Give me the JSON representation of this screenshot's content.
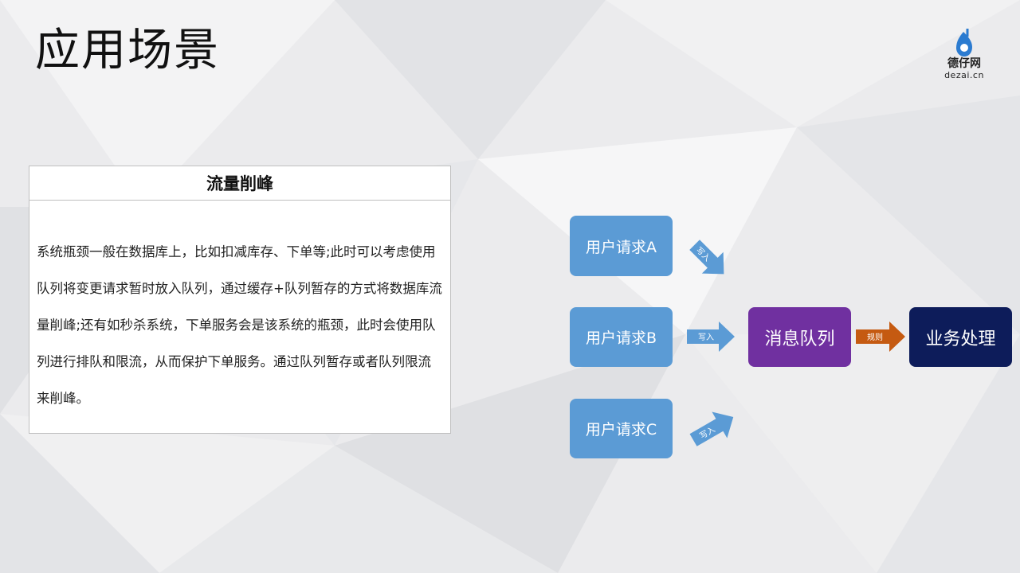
{
  "slide": {
    "title": "应用场景"
  },
  "logo": {
    "name": "德仔网",
    "domain": "dezai.cn"
  },
  "card": {
    "heading": "流量削峰",
    "body": "系统瓶颈一般在数据库上，比如扣减库存、下单等;此时可以考虑使用队列将变更请求暂时放入队列，通过缓存+队列暂存的方式将数据库流量削峰;还有如秒杀系统，下单服务会是该系统的瓶颈，此时会使用队列进行排队和限流，从而保护下单服务。通过队列暂存或者队列限流来削峰。"
  },
  "diagram": {
    "nodes": {
      "request_a": "用户请求A",
      "request_b": "用户请求B",
      "request_c": "用户请求C",
      "queue": "消息队列",
      "business": "业务处理"
    },
    "arrows": {
      "write_a": "写入",
      "write_b": "写入",
      "write_c": "写入",
      "rule": "规则"
    },
    "colors": {
      "request": "#5b9bd5",
      "queue": "#7030a0",
      "business": "#0d1c5a",
      "write_arrow": "#5b9bd5",
      "rule_arrow": "#c55a11"
    }
  }
}
